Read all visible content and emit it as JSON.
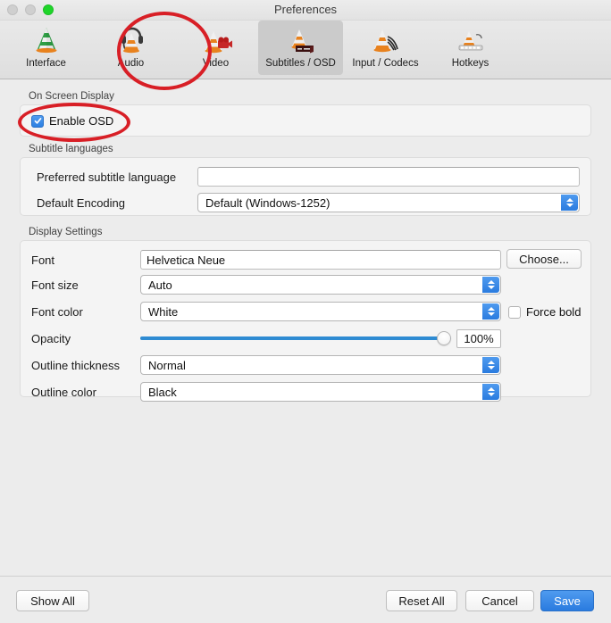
{
  "window": {
    "title": "Preferences",
    "traffic_lights": [
      {
        "name": "close",
        "color": "#cfcfcf"
      },
      {
        "name": "minimize",
        "color": "#cfcfcf"
      },
      {
        "name": "zoom",
        "color": "#1fd52a"
      }
    ]
  },
  "toolbar": {
    "tabs": [
      {
        "label": "Interface",
        "icon": "vlc-cone-interface-icon",
        "selected": false
      },
      {
        "label": "Audio",
        "icon": "vlc-cone-headphones-icon",
        "selected": false
      },
      {
        "label": "Video",
        "icon": "vlc-cone-video-icon",
        "selected": false
      },
      {
        "label": "Subtitles / OSD",
        "icon": "vlc-cone-subtitles-icon",
        "selected": true
      },
      {
        "label": "Input / Codecs",
        "icon": "vlc-cone-input-icon",
        "selected": false
      },
      {
        "label": "Hotkeys",
        "icon": "vlc-cone-hotkeys-icon",
        "selected": false
      }
    ]
  },
  "osd_group": {
    "title": "On Screen Display",
    "enable_osd": {
      "label": "Enable OSD",
      "checked": true
    }
  },
  "subtitle_languages_group": {
    "title": "Subtitle languages",
    "preferred_language": {
      "label": "Preferred subtitle language",
      "value": "",
      "placeholder": ""
    },
    "default_encoding": {
      "label": "Default Encoding",
      "value": "Default (Windows-1252)"
    }
  },
  "display_settings_group": {
    "title": "Display Settings",
    "font": {
      "label": "Font",
      "value": "Helvetica Neue"
    },
    "choose_button": "Choose...",
    "font_size": {
      "label": "Font size",
      "value": "Auto"
    },
    "font_color": {
      "label": "Font color",
      "value": "White"
    },
    "force_bold": {
      "label": "Force bold",
      "checked": false
    },
    "opacity": {
      "label": "Opacity",
      "value": "100%",
      "percent": 100
    },
    "outline_thickness": {
      "label": "Outline thickness",
      "value": "Normal"
    },
    "outline_color": {
      "label": "Outline color",
      "value": "Black"
    }
  },
  "footer": {
    "show_all": "Show All",
    "reset_all": "Reset All",
    "cancel": "Cancel",
    "save": "Save"
  },
  "annotations": {
    "accent_color": "#d81f26",
    "items": [
      {
        "name": "highlight-subtitles-osd-tab",
        "shape": "ellipse"
      },
      {
        "name": "highlight-enable-osd-checkbox",
        "shape": "ellipse"
      }
    ]
  }
}
